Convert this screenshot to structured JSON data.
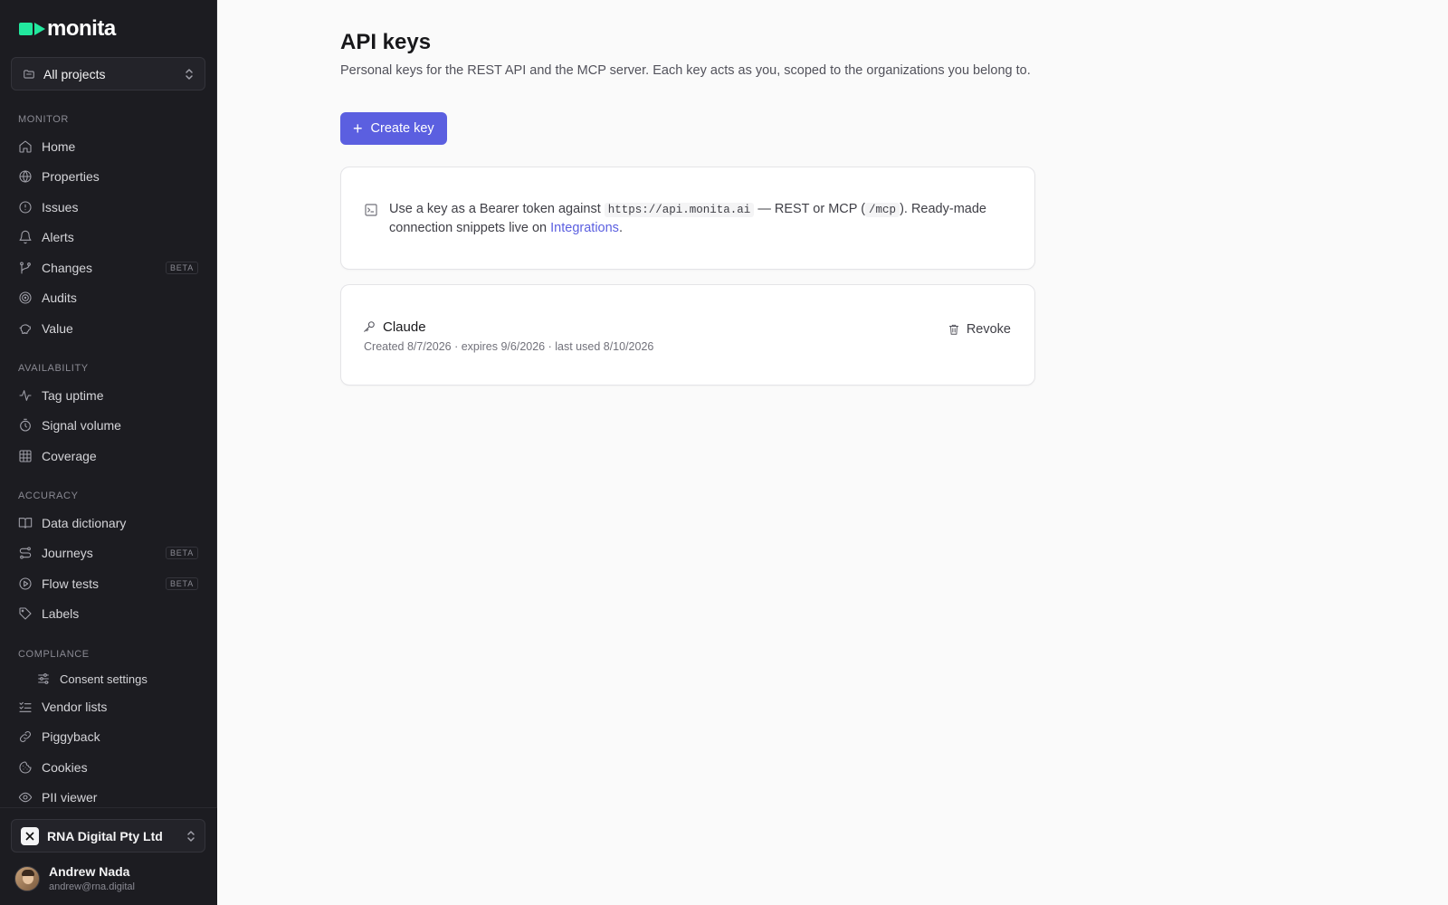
{
  "brand": {
    "name": "monita",
    "accent": "#22e89e",
    "primary": "#5b5fe0"
  },
  "project_selector": {
    "label": "All projects"
  },
  "nav": {
    "monitor": {
      "title": "MONITOR",
      "items": [
        {
          "label": "Home",
          "icon": "home-icon"
        },
        {
          "label": "Properties",
          "icon": "globe-icon"
        },
        {
          "label": "Issues",
          "icon": "alert-circle-icon"
        },
        {
          "label": "Alerts",
          "icon": "bell-icon"
        },
        {
          "label": "Changes",
          "icon": "git-branch-icon",
          "badge": "BETA"
        },
        {
          "label": "Audits",
          "icon": "target-icon"
        },
        {
          "label": "Value",
          "icon": "piggy-bank-icon"
        }
      ]
    },
    "availability": {
      "title": "AVAILABILITY",
      "items": [
        {
          "label": "Tag uptime",
          "icon": "activity-icon"
        },
        {
          "label": "Signal volume",
          "icon": "timer-icon"
        },
        {
          "label": "Coverage",
          "icon": "grid-icon"
        }
      ]
    },
    "accuracy": {
      "title": "ACCURACY",
      "items": [
        {
          "label": "Data dictionary",
          "icon": "book-icon"
        },
        {
          "label": "Journeys",
          "icon": "route-icon",
          "badge": "BETA"
        },
        {
          "label": "Flow tests",
          "icon": "play-circle-icon",
          "badge": "BETA"
        },
        {
          "label": "Labels",
          "icon": "tag-icon"
        }
      ]
    },
    "compliance": {
      "title": "COMPLIANCE",
      "items": [
        {
          "label": "Consent settings",
          "icon": "sliders-icon"
        },
        {
          "label": "Vendor lists",
          "icon": "list-checks-icon"
        },
        {
          "label": "Piggyback",
          "icon": "link-icon"
        },
        {
          "label": "Cookies",
          "icon": "cookie-icon"
        },
        {
          "label": "PII viewer",
          "icon": "eye-icon"
        }
      ]
    }
  },
  "org_selector": {
    "label": "RNA Digital Pty Ltd"
  },
  "user": {
    "name": "Andrew Nada",
    "email": "andrew@rna.digital"
  },
  "page": {
    "title": "API keys",
    "description": "Personal keys for the REST API and the MCP server. Each key acts as you, scoped to the organizations you belong to.",
    "create_button": "Create key"
  },
  "info": {
    "text_1": "Use a key as a Bearer token against ",
    "code_1": "https://api.monita.ai",
    "text_2": " — REST or MCP (",
    "code_2": "/mcp",
    "text_3": "). Ready-made connection snippets live on ",
    "link": "Integrations",
    "text_4": "."
  },
  "keys": [
    {
      "name": "Claude",
      "meta": "Created 8/7/2026 · expires 9/6/2026 · last used 8/10/2026",
      "action": "Revoke"
    }
  ]
}
